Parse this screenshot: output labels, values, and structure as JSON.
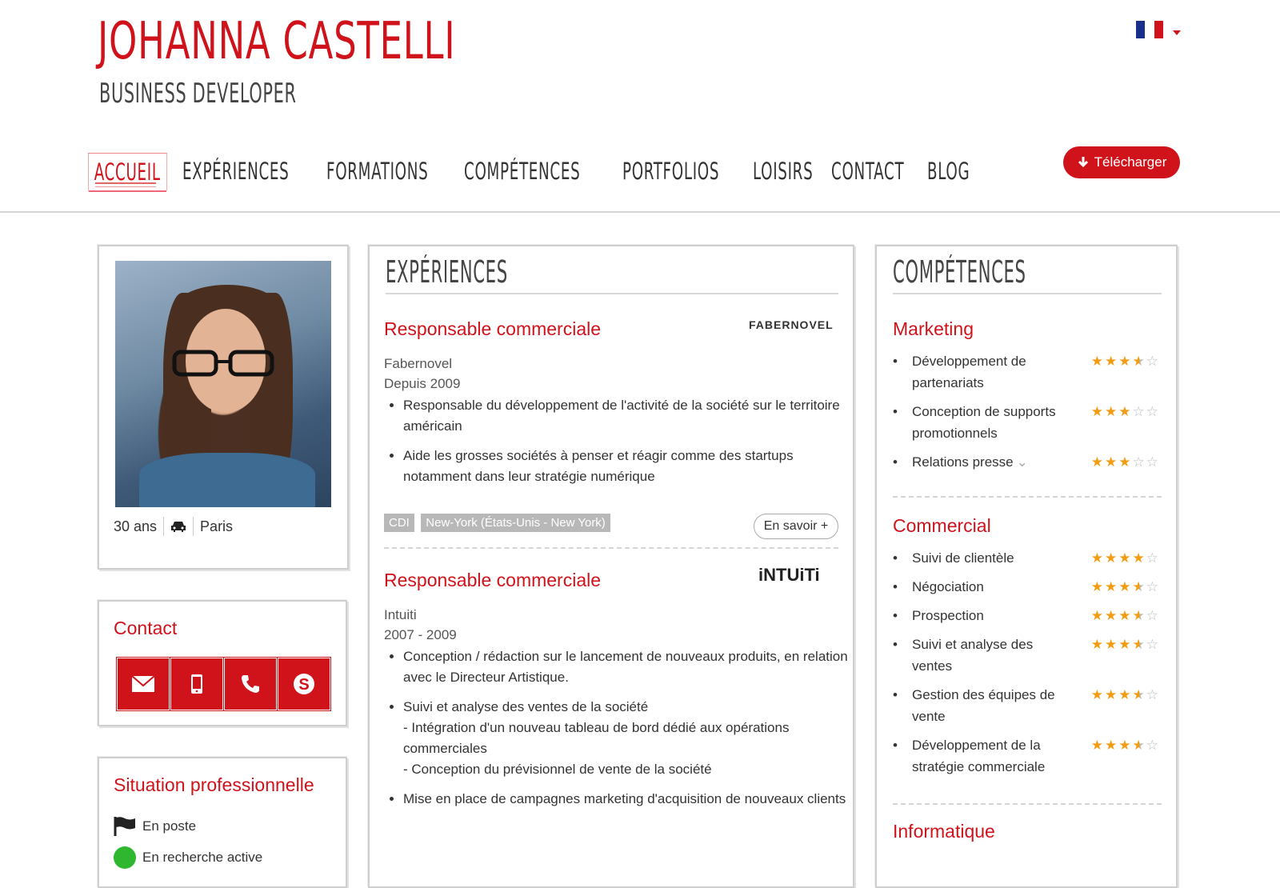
{
  "header": {
    "name": "JOHANNA CASTELLI",
    "title": "BUSINESS DEVELOPER",
    "language": "FR",
    "download_label": "Télécharger"
  },
  "nav": {
    "items": [
      "ACCUEIL",
      "EXPÉRIENCES",
      "FORMATIONS",
      "COMPÉTENCES",
      "PORTFOLIOS",
      "LOISIRS",
      "CONTACT",
      "BLOG"
    ],
    "active": "ACCUEIL"
  },
  "profile": {
    "age": "30 ans",
    "city": "Paris"
  },
  "contact": {
    "title": "Contact",
    "buttons": [
      "email-icon",
      "mobile-icon",
      "phone-icon",
      "skype-icon"
    ]
  },
  "situation": {
    "title": "Situation professionnelle",
    "status": "En poste",
    "search": "En recherche active"
  },
  "experiences": {
    "title": "EXPÉRIENCES",
    "jobs": [
      {
        "title": "Responsable commerciale",
        "logo": "FABERNOVEL",
        "company": "Fabernovel",
        "period": "Depuis 2009",
        "items": [
          "Responsable du développement de l'activité de la société sur le territoire américain",
          "Aide les grosses sociétés à penser et réagir comme des startups notamment dans leur stratégie numérique"
        ],
        "tags": [
          "CDI",
          "New-York (États-Unis - New York)"
        ],
        "more": "En savoir +"
      },
      {
        "title": "Responsable commerciale",
        "logo": "iNTUiTi",
        "company": "Intuiti",
        "period": "2007 - 2009",
        "items": [
          "Conception / rédaction sur le lancement de nouveaux produits, en relation avec le Directeur Artistique.",
          "Suivi et analyse des ventes de la société\n- Intégration d'un nouveau tableau de bord dédié aux opérations commerciales\n- Conception du prévisionnel de vente de la société",
          "Mise en place de campagnes marketing d'acquisition de nouveaux clients"
        ]
      }
    ]
  },
  "skills": {
    "title": "COMPÉTENCES",
    "groups": [
      {
        "name": "Marketing",
        "items": [
          {
            "label": "Développement de partenariats",
            "rating": 3.5
          },
          {
            "label": "Conception de supports promotionnels",
            "rating": 3
          },
          {
            "label": "Relations presse",
            "rating": 3
          }
        ]
      },
      {
        "name": "Commercial",
        "items": [
          {
            "label": "Suivi de clientèle",
            "rating": 4
          },
          {
            "label": "Négociation",
            "rating": 3.5
          },
          {
            "label": "Prospection",
            "rating": 3.5
          },
          {
            "label": "Suivi et analyse des ventes",
            "rating": 3.5
          },
          {
            "label": "Gestion des équipes de vente",
            "rating": 3.5
          },
          {
            "label": "Développement de la stratégie commerciale",
            "rating": 3.5
          }
        ]
      },
      {
        "name": "Informatique",
        "items": []
      }
    ]
  },
  "colors": {
    "accent": "#d0131b",
    "star": "#f39c12",
    "status_ok": "#2fb82f"
  }
}
